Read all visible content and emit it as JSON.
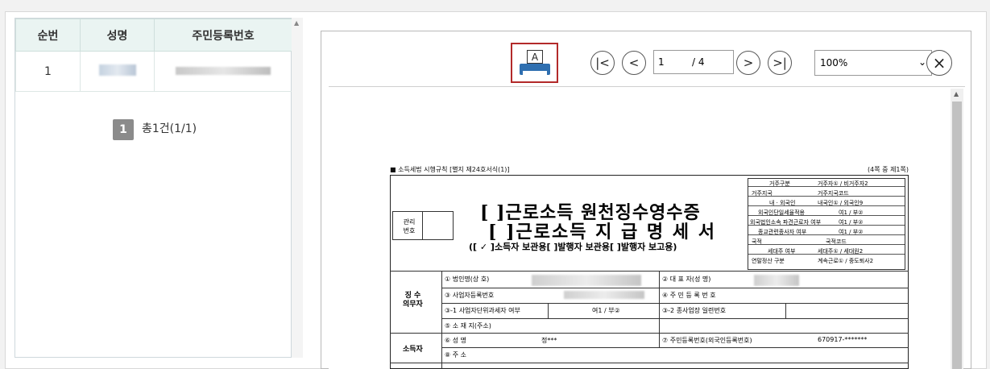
{
  "grid": {
    "headers": [
      "순번",
      "성명",
      "주민등록번호"
    ],
    "rows": [
      {
        "no": "1"
      }
    ]
  },
  "pager": {
    "page": "1",
    "total": "총1건(1/1)"
  },
  "viewer": {
    "print_icon_letter": "A",
    "first_label": "|<",
    "prev_label": "<",
    "next_label": ">",
    "last_label": ">|",
    "page_current": "1",
    "page_total": "/ 4",
    "zoom": "100%",
    "zoom_chevron": "⌄",
    "close_label": "×"
  },
  "document": {
    "caption_left": "■ 소득세법 시행규칙 [별지 제24호서식(1)]",
    "caption_right": "(4쪽 중 제1쪽)",
    "title1": "[  ]근로소득 원천징수영수증",
    "title2": "[  ]근로소득 지 급 명 세 서",
    "subtitle": "([ ✓ ]소득자 보관용[    ]발행자 보관용[    ]발행자 보고용)",
    "mgmt_label": "관리\n번호",
    "right_rows": [
      [
        "거주구분",
        "거주자① / 비거주자2"
      ],
      [
        "거주지국",
        "거주지국코드"
      ],
      [
        "내 · 외국인",
        "내국인① / 외국인9"
      ],
      [
        "외국인단일세율적용",
        "여1 / 부②"
      ],
      [
        "외국법인소속 파견근로자 여부",
        "여1 / 부②"
      ],
      [
        "종교관련종사자 여부",
        "여1 / 부②"
      ],
      [
        "국적",
        "국적코드"
      ],
      [
        "세대주 여부",
        "세대주① / 세대원2"
      ],
      [
        "연말정산 구분",
        "계속근로① / 중도퇴사2"
      ]
    ],
    "sec1_label": "징 수\n의무자",
    "sec1_rows": {
      "r1a": "① 법인명(상 호)",
      "r1b": "② 대 표 자(성   명)",
      "r2a": "③ 사업자등록번호",
      "r2b": "④ 주 민 등 록 번 호",
      "r3a": "③-1 사업자단위과세자 여부",
      "r3a_val": "여1 / 부②",
      "r3b": "③-2 종사업장 일련번호",
      "r4a": "⑤ 소 재 지(주소)"
    },
    "sec2_label": "소득자",
    "sec2_rows": {
      "r1a": "⑥ 성       명",
      "r1a_val": "정***",
      "r1b": "⑦ 주민등록번호(외국인등록번호)",
      "r1b_val": "670917-*******",
      "r2a": "⑧ 주       소"
    }
  }
}
